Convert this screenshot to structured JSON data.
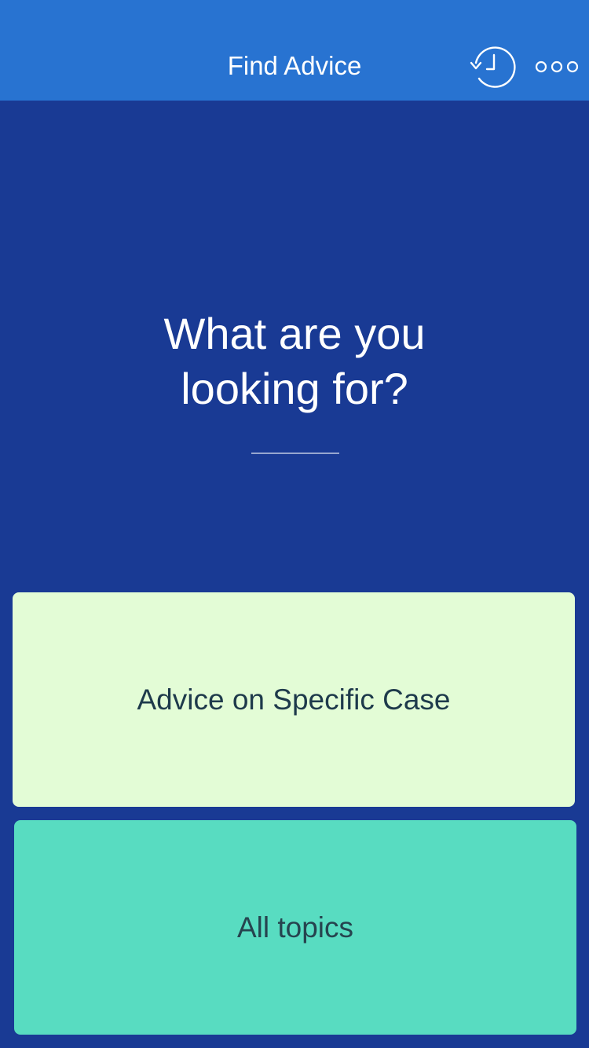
{
  "header": {
    "title": "Find Advice",
    "history_icon": "history-icon",
    "more_icon": "more-options-icon"
  },
  "main": {
    "question": "What are you\nlooking for?",
    "options": [
      {
        "label": "Advice on Specific Case",
        "color": "#e3fcd6"
      },
      {
        "label": "All topics",
        "color": "#58dcc1"
      }
    ]
  },
  "colors": {
    "nav_bar": "#2873d1",
    "background": "#193a94",
    "text_light": "#ffffff",
    "text_dark": "#1e3a4b"
  }
}
